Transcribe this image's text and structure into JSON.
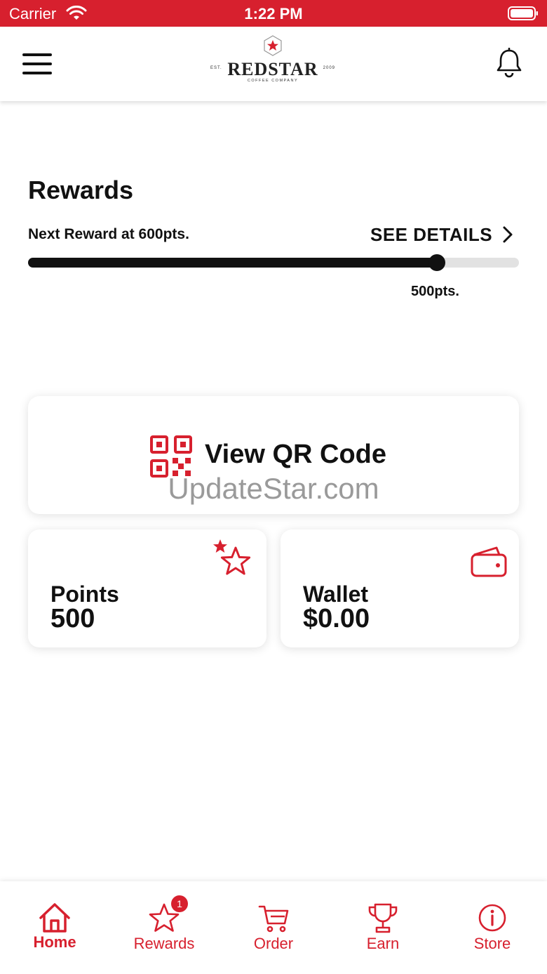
{
  "status_bar": {
    "carrier": "Carrier",
    "time": "1:22 PM"
  },
  "header": {
    "brand": {
      "name": "REDSTAR",
      "est": "EST.",
      "year": "2009",
      "tagline": "COFFEE COMPANY"
    },
    "icons": {
      "menu": "hamburger-menu-icon",
      "notifications": "bell-icon"
    }
  },
  "rewards": {
    "title": "Rewards",
    "next_reward": "Next Reward at 600pts.",
    "see_details": "SEE DETAILS",
    "current_points_label": "500pts.",
    "progress_fraction": 0.833
  },
  "qr_card": {
    "label": "View QR Code",
    "watermark": "UpdateStar.com",
    "icon": "qr-code-icon"
  },
  "points_card": {
    "title": "Points",
    "value": "500",
    "icon": "stars-icon"
  },
  "wallet_card": {
    "title": "Wallet",
    "value": "$0.00",
    "icon": "wallet-icon"
  },
  "tab_bar": {
    "tabs": [
      {
        "label": "Home",
        "icon": "home-icon",
        "active": true
      },
      {
        "label": "Rewards",
        "icon": "star-icon",
        "badge": "1"
      },
      {
        "label": "Order",
        "icon": "cart-icon"
      },
      {
        "label": "Earn",
        "icon": "trophy-icon"
      },
      {
        "label": "Store",
        "icon": "info-icon"
      }
    ]
  },
  "colors": {
    "brand_red": "#d7202e",
    "text": "#111111",
    "track": "#e2e2e2"
  }
}
